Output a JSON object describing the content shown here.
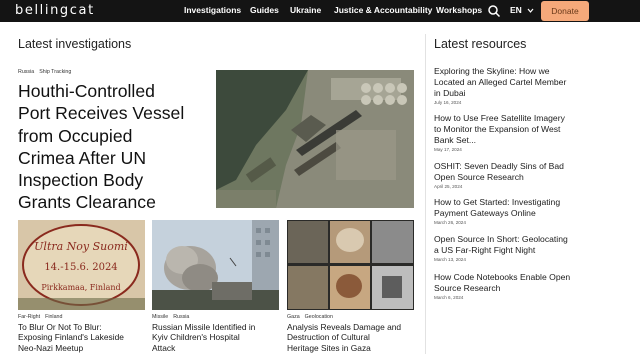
{
  "nav": {
    "logo": "bellingcat",
    "items": [
      "Investigations",
      "Guides",
      "Ukraine",
      "Justice & Accountability",
      "Workshops"
    ],
    "language": "EN",
    "donate": "Donate"
  },
  "main": {
    "section_title": "Latest investigations",
    "featured": {
      "tags": [
        "Russia",
        "Ship Tracking"
      ],
      "title_lines": [
        "Houthi-Controlled",
        "Port Receives Vessel",
        "from Occupied",
        "Crimea After UN",
        "Inspection Body",
        "Grants Clearance"
      ]
    },
    "cards": [
      {
        "tags": [
          "Far-Right",
          "Finland"
        ],
        "title_lines": [
          "To Blur Or Not To Blur:",
          "Exposing Finland's Lakeside",
          "Neo-Nazi Meetup"
        ],
        "image_text_lines": [
          "Ultra Noy Suomi",
          "14.-15.6. 2024",
          "Pirkkamaa, Finland"
        ]
      },
      {
        "tags": [
          "Missile",
          "Russia"
        ],
        "title_lines": [
          "Russian Missile Identified in",
          "Kyiv Children's Hospital",
          "Attack"
        ]
      },
      {
        "tags": [
          "Gaza",
          "Geolocation"
        ],
        "title_lines": [
          "Analysis Reveals Damage and",
          "Destruction of Cultural",
          "Heritage Sites in Gaza"
        ]
      }
    ]
  },
  "resources": {
    "section_title": "Latest resources",
    "items": [
      {
        "title_lines": [
          "Exploring the Skyline: How we",
          "Located an Alleged Cartel Member",
          "in Dubai"
        ],
        "date": "July 16, 2024"
      },
      {
        "title_lines": [
          "How to Use Free Satellite Imagery",
          "to Monitor the Expansion of West",
          "Bank Set..."
        ],
        "date": "May 17, 2024"
      },
      {
        "title_lines": [
          "OSHIT: Seven Deadly Sins of Bad",
          "Open Source Research"
        ],
        "date": "April 25, 2024"
      },
      {
        "title_lines": [
          "How to Get Started: Investigating",
          "Payment Gateways Online"
        ],
        "date": "March 26, 2024"
      },
      {
        "title_lines": [
          "Open Source In Short: Geolocating",
          "a US Far-Right Fight Night"
        ],
        "date": "March 13, 2024"
      },
      {
        "title_lines": [
          "How Code Notebooks Enable Open",
          "Source Research"
        ],
        "date": "March 6, 2024"
      }
    ]
  },
  "colors": {
    "nav_bg": "#141414",
    "donate_bg": "#f5a97a",
    "text": "#1b1b1b"
  }
}
